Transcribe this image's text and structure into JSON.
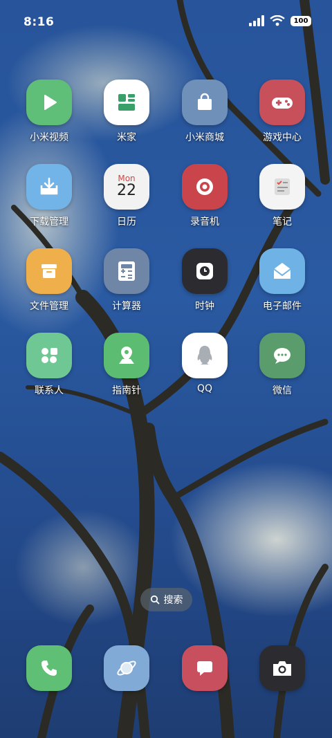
{
  "status_bar": {
    "time": "8:16",
    "battery": "100"
  },
  "apps": [
    {
      "id": "mi-video",
      "label": "小米视频",
      "color": "#5fbf78",
      "icon": "play-icon"
    },
    {
      "id": "mi-home",
      "label": "米家",
      "color": "#ffffff",
      "icon": "layout-icon"
    },
    {
      "id": "mi-store",
      "label": "小米商城",
      "color": "#6f90b8",
      "icon": "shopping-bag-icon"
    },
    {
      "id": "game-center",
      "label": "游戏中心",
      "color": "#c8505a",
      "icon": "gamepad-icon"
    },
    {
      "id": "downloads",
      "label": "下载管理",
      "color": "#72b4e8",
      "icon": "download-icon"
    },
    {
      "id": "calendar",
      "label": "日历",
      "color": "#f2f2f2",
      "icon": "calendar-icon",
      "month": "Mon",
      "day": "22"
    },
    {
      "id": "recorder",
      "label": "录音机",
      "color": "#c9454b",
      "icon": "record-icon"
    },
    {
      "id": "notes",
      "label": "笔记",
      "color": "#f4f4f4",
      "icon": "checklist-icon"
    },
    {
      "id": "file-manager",
      "label": "文件管理",
      "color": "#efb04c",
      "icon": "archive-box-icon"
    },
    {
      "id": "calculator",
      "label": "计算器",
      "color": "#6f86a6",
      "icon": "calculator-icon"
    },
    {
      "id": "clock",
      "label": "时钟",
      "color": "#2c2c30",
      "icon": "clock-icon"
    },
    {
      "id": "email",
      "label": "电子邮件",
      "color": "#6fb3e6",
      "icon": "envelope-icon"
    },
    {
      "id": "contacts",
      "label": "联系人",
      "color": "#6fc894",
      "icon": "contacts-icon"
    },
    {
      "id": "compass",
      "label": "指南针",
      "color": "#5cbc72",
      "icon": "map-pin-icon"
    },
    {
      "id": "qq",
      "label": "QQ",
      "color": "#ffffff",
      "icon": "penguin-icon"
    },
    {
      "id": "wechat",
      "label": "微信",
      "color": "#5a9c6c",
      "icon": "chat-bubble-icon"
    }
  ],
  "search": {
    "label": "搜索"
  },
  "dock": [
    {
      "id": "phone",
      "color": "#5fbf74",
      "icon": "phone-icon"
    },
    {
      "id": "browser",
      "color": "#82aad6",
      "icon": "planet-icon"
    },
    {
      "id": "messages",
      "color": "#c8505e",
      "icon": "message-icon"
    },
    {
      "id": "camera",
      "color": "#2c2c30",
      "icon": "camera-icon"
    }
  ]
}
